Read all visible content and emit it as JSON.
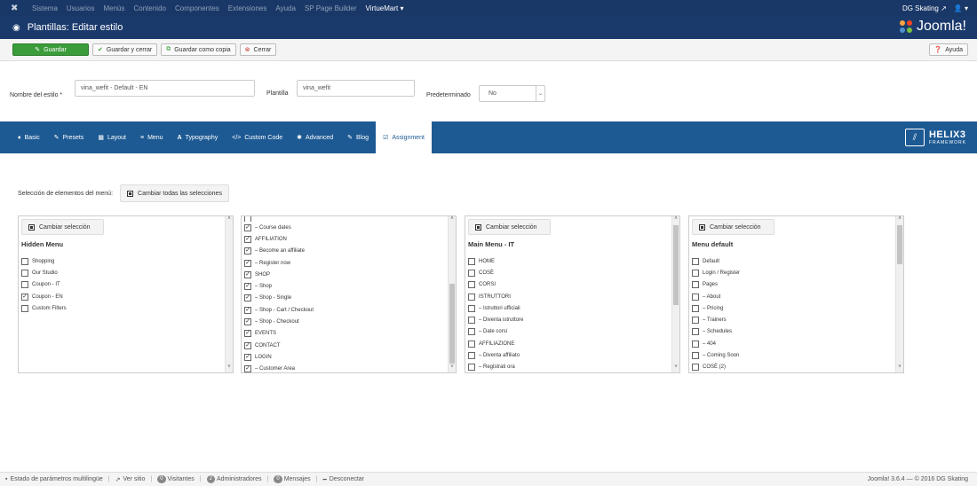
{
  "topnav": {
    "items": [
      "Sistema",
      "Usuarios",
      "Menús",
      "Contenido",
      "Componentes",
      "Extensiones",
      "Ayuda",
      "SP Page Builder",
      "VirtueMart ▾"
    ],
    "site_name": "DG Skating ↗",
    "user": "👤 ▾"
  },
  "header": {
    "title": "Plantillas: Editar estilo",
    "brand": "Joomla!"
  },
  "toolbar": {
    "save": "Guardar",
    "save_close": "Guardar y cerrar",
    "save_copy": "Guardar como copia",
    "close": "Cerrar",
    "help": "Ayuda"
  },
  "form": {
    "style_name_label": "Nombre del estilo *",
    "style_name_value": "vina_wefit - Default - EN",
    "template_label": "Plantilla",
    "template_value": "vina_wefit",
    "default_label": "Predeterminado",
    "default_value": "No"
  },
  "helix": {
    "tabs": [
      {
        "icon": "♦",
        "label": "Basic"
      },
      {
        "icon": "✎",
        "label": "Presets"
      },
      {
        "icon": "▦",
        "label": "Layout"
      },
      {
        "icon": "≡",
        "label": "Menu"
      },
      {
        "icon": "A",
        "label": "Typography"
      },
      {
        "icon": "</>",
        "label": "Custom Code"
      },
      {
        "icon": "✱",
        "label": "Advanced"
      },
      {
        "icon": "✎",
        "label": "Blog"
      },
      {
        "icon": "☑",
        "label": "Assignment"
      }
    ],
    "logo_text": "HELIX3",
    "logo_sub": "FRAMEWORK"
  },
  "assignment": {
    "label": "Selección de elementos del menú:",
    "toggle_all": "Cambiar todas las selecciones",
    "toggle": "Cambiar selección"
  },
  "panels": [
    {
      "title": "Hidden Menu",
      "items": [
        {
          "label": "Shopping",
          "checked": false
        },
        {
          "label": "Our Studio",
          "checked": false
        },
        {
          "label": "Coupon - IT",
          "checked": false
        },
        {
          "label": "Coupon - EN",
          "checked": true
        },
        {
          "label": "Custom Filters",
          "checked": false
        }
      ]
    },
    {
      "title": "",
      "items": [
        {
          "label": "– Course dates",
          "checked": true
        },
        {
          "label": "AFFILIATION",
          "checked": true
        },
        {
          "label": "– Become an affiliate",
          "checked": true
        },
        {
          "label": "– Register now",
          "checked": true
        },
        {
          "label": "SHOP",
          "checked": true
        },
        {
          "label": "– Shop",
          "checked": true
        },
        {
          "label": "– Shop - Single",
          "checked": true
        },
        {
          "label": "– Shop - Cart / Checkout",
          "checked": true
        },
        {
          "label": "– Shop - Checkout",
          "checked": true
        },
        {
          "label": "EVENTS",
          "checked": true
        },
        {
          "label": "CONTACT",
          "checked": true
        },
        {
          "label": "LOGIN",
          "checked": true
        },
        {
          "label": "– Customer Area",
          "checked": true
        }
      ]
    },
    {
      "title": "Main Menu - IT",
      "items": [
        {
          "label": "HOME",
          "checked": false
        },
        {
          "label": "COSÈ",
          "checked": false
        },
        {
          "label": "CORSI",
          "checked": false
        },
        {
          "label": "ISTRUTTORI",
          "checked": false
        },
        {
          "label": "– Istruttori ufficiali",
          "checked": false
        },
        {
          "label": "– Diventa istruttore",
          "checked": false
        },
        {
          "label": "– Date corsi",
          "checked": false
        },
        {
          "label": "AFFILIAZIONE",
          "checked": false
        },
        {
          "label": "– Diventa affiliato",
          "checked": false
        },
        {
          "label": "– Registrati ora",
          "checked": false
        }
      ]
    },
    {
      "title": "Menu default",
      "items": [
        {
          "label": "Default",
          "checked": false
        },
        {
          "label": "Login / Register",
          "checked": false
        },
        {
          "label": "Pages",
          "checked": false
        },
        {
          "label": "– About",
          "checked": false
        },
        {
          "label": "– Pricing",
          "checked": false
        },
        {
          "label": "– Trainers",
          "checked": false
        },
        {
          "label": "– Schedules",
          "checked": false
        },
        {
          "label": "– 404",
          "checked": false
        },
        {
          "label": "– Coming Soon",
          "checked": false
        },
        {
          "label": "COSÈ (2)",
          "checked": false
        }
      ]
    }
  ],
  "footer": {
    "multilang": "Estado de parámetros multilingüe",
    "view_site": "Ver sitio",
    "visitors_count": "0",
    "visitors": "Visitantes",
    "admins_count": "2",
    "admins": "Administradores",
    "messages_count": "0",
    "messages": "Mensajes",
    "logout": "Desconectar",
    "version": "Joomla! 3.6.4 — © 2016 DG Skating"
  }
}
